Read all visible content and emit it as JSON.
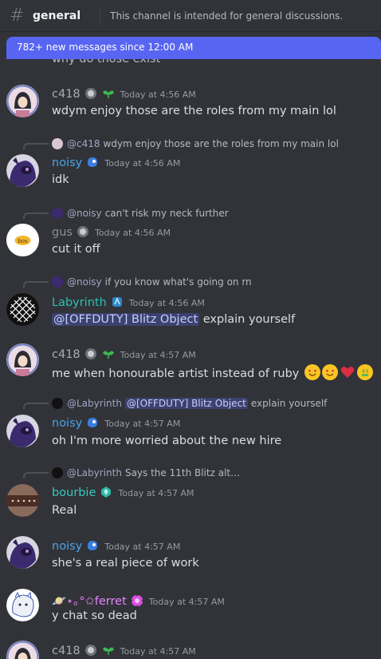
{
  "header": {
    "channel": "general",
    "topic": "This channel is intended for general discussions."
  },
  "banner": {
    "text": "782+ new messages since 12:00 AM"
  },
  "partial_top": {
    "text": "why do those exist"
  },
  "messages": [
    {
      "author": "c418",
      "time": "Today at 4:56 AM",
      "text": "wdym enjoy those are the roles from my main lol"
    },
    {
      "reply_name": "@c418",
      "reply_text": "wdym enjoy those are the roles from my main lol",
      "author": "noisy",
      "time": "Today at 4:56 AM",
      "text": "idk"
    },
    {
      "reply_name": "@noisy",
      "reply_text": "can't risk my neck further",
      "author": "gus",
      "time": "Today at 4:56 AM",
      "text": "cut it off"
    },
    {
      "reply_name": "@noisy",
      "reply_text": "if you know what's going on rn",
      "author": "Labyrinth",
      "time": "Today at 4:56 AM",
      "mention": "@[OFFDUTY] Blitz Object",
      "text": "explain yourself"
    },
    {
      "author": "c418",
      "time": "Today at 4:57 AM",
      "text": "me when honourable artist instead of ruby"
    },
    {
      "reply_name": "@Labyrinth",
      "reply_mention": "@[OFFDUTY] Blitz Object",
      "reply_text": "explain yourself",
      "author": "noisy",
      "time": "Today at 4:57 AM",
      "text": "oh I'm more worried about the new hire"
    },
    {
      "reply_name": "@Labyrinth",
      "reply_text": "Says the 11th Blitz alt…",
      "author": "bourbie",
      "time": "Today at 4:57 AM",
      "text": "Real"
    },
    {
      "author": "noisy",
      "time": "Today at 4:57 AM",
      "text": "she's a real piece of work"
    },
    {
      "author": "🪐⋆｡°✩ferret",
      "time": "Today at 4:57 AM",
      "text": "y chat so dead"
    },
    {
      "author": "c418",
      "time": "Today at 4:57 AM"
    }
  ],
  "emojis": [
    "heart-eyes",
    "heart-eyes",
    "red-heart",
    "money-mouth"
  ],
  "colors": {
    "background": "#313338",
    "accent": "#5865f2",
    "noisy": "#4aa3e8",
    "labyrinth": "#2bc0b4",
    "ferret": "#e884ff"
  }
}
